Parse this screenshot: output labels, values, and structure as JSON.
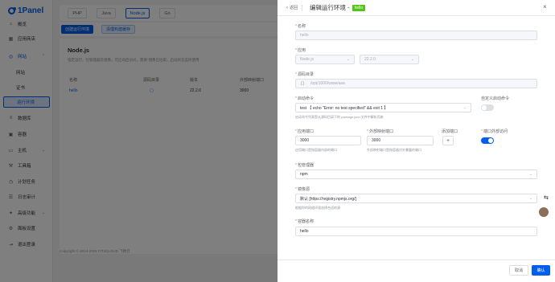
{
  "app": {
    "logo_text": "1Panel"
  },
  "sidebar": {
    "items": [
      {
        "label": "概览",
        "icon": "home-icon"
      },
      {
        "label": "应用商店",
        "icon": "store-icon"
      },
      {
        "label": "网站",
        "icon": "globe-icon"
      },
      {
        "label": "网站",
        "icon": ""
      },
      {
        "label": "证书",
        "icon": ""
      },
      {
        "label": "运行环境",
        "icon": ""
      },
      {
        "label": "数据库",
        "icon": "database-icon"
      },
      {
        "label": "容器",
        "icon": "container-icon"
      },
      {
        "label": "主机",
        "icon": "host-icon"
      },
      {
        "label": "工具箱",
        "icon": "toolbox-icon"
      },
      {
        "label": "计划任务",
        "icon": "clock-icon"
      },
      {
        "label": "日志审计",
        "icon": "log-icon"
      },
      {
        "label": "高级功能",
        "icon": "star-icon"
      },
      {
        "label": "面板设置",
        "icon": "gear-icon"
      },
      {
        "label": "退出登录",
        "icon": "logout-icon"
      }
    ]
  },
  "main": {
    "tabs": [
      "PHP",
      "Java",
      "Node.js",
      "Go"
    ],
    "create_button": "创建运行环境",
    "rebuild_button": "清理构建缓存",
    "title": "Node.js",
    "description": "指定运行、包管理器及镜像，可启动后访问，需要·镜像已拉取，启动状态监听使用",
    "table_headers": [
      "名称",
      "源码目录",
      "版本",
      "外部映射端口"
    ],
    "row": {
      "name": "hello",
      "version": "22.2.0",
      "port": "3000"
    },
    "footer": "Copyright © 2014-2024 FIT2CLOUD 飞致云"
  },
  "drawer": {
    "back": "返回",
    "title": "编辑运行环境 -",
    "name_badge": "hello",
    "name_label": "名称",
    "name_value": "hello",
    "app_label": "应用",
    "app_value": "Node.js",
    "version_value": "22.2.0",
    "code_dir_label": "源码目录",
    "code_dir_value": "/opt/1000/www/aaa",
    "start_cmd_label": "启动命令",
    "start_cmd_value": "test 【 echo \"Error: no test specified\" && exit 1 】",
    "start_cmd_hint": "启动命令列表是从源码目录下的 package.json 文件中解析而来",
    "custom_cmd_label": "自定义启动命令",
    "custom_cmd_on": false,
    "app_port_label": "应用端口",
    "app_port_value": "3000",
    "app_port_hint": "应用端口是指容器内部的端口",
    "ext_port_label": "外部映射端口",
    "ext_port_value": "3000",
    "ext_port_hint": "外部映射端口是指容器对外暴露的端口",
    "add_port_label": "添加端口",
    "port_ext_access_label": "端口外部访问",
    "port_ext_access_on": true,
    "pkg_manager_label": "包管理器",
    "pkg_manager_value": "npm",
    "mirror_label": "镜像源",
    "mirror_value": "默认 [https://registry.npmjs.org/]",
    "mirror_hint": "根据你的网络环境选择合适的源",
    "container_name_label": "容器名称",
    "container_name_value": "hello",
    "cancel": "取消",
    "confirm": "确认"
  },
  "colors": {
    "primary": "#005eeb",
    "badge": "#52c41a"
  }
}
